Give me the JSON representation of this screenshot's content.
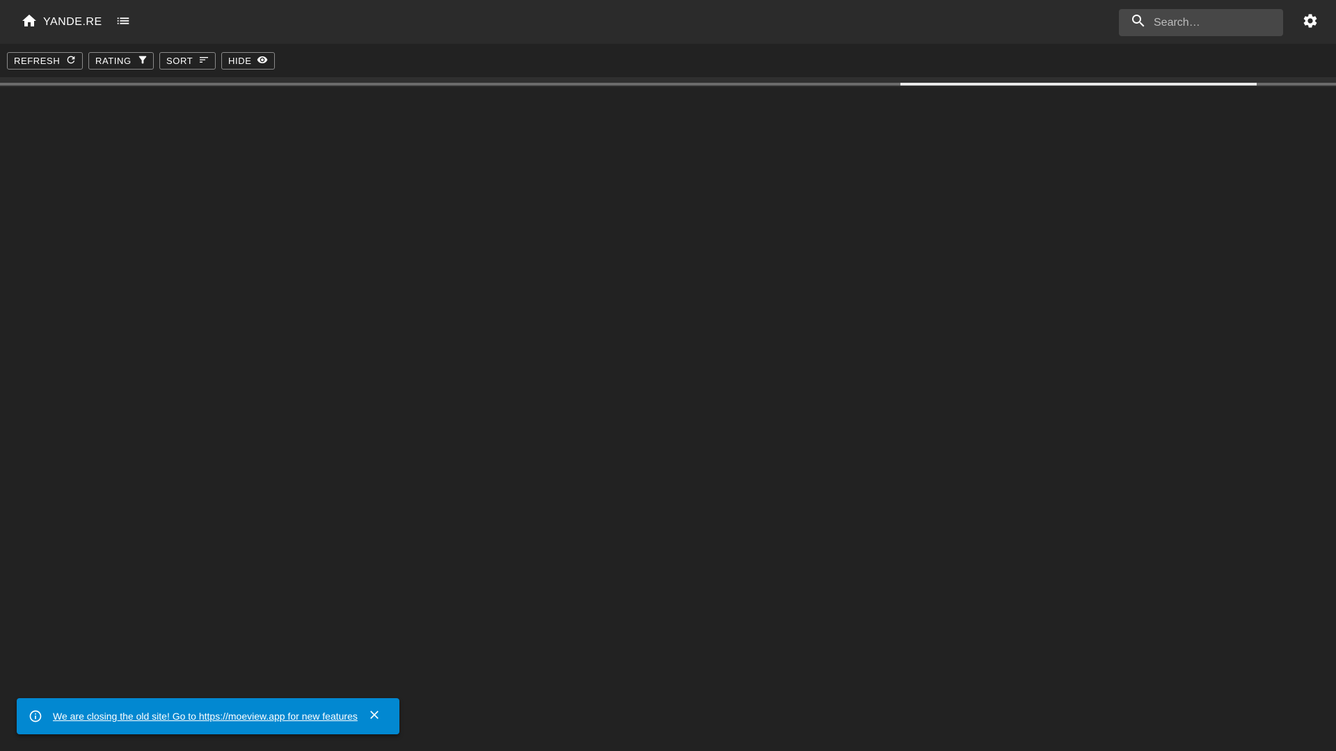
{
  "appbar": {
    "home_label": "YANDE.RE",
    "home_icon": "home-icon",
    "list_icon": "list-icon",
    "settings_icon": "gear-icon"
  },
  "search": {
    "placeholder": "Search…",
    "value": "",
    "icon": "search-icon"
  },
  "toolbar": {
    "buttons": [
      {
        "label": "REFRESH",
        "icon": "refresh-icon"
      },
      {
        "label": "RATING",
        "icon": "filter-icon"
      },
      {
        "label": "SORT",
        "icon": "sort-icon"
      },
      {
        "label": "HIDE",
        "icon": "eye-icon"
      }
    ]
  },
  "loading": {
    "indeterminate": true
  },
  "snackbar": {
    "message": "We are closing the old site! Go to https://moeview.app for new features",
    "info_icon": "info-icon",
    "close_icon": "close-icon"
  },
  "colors": {
    "background": "#222222",
    "appbar": "#2b2b2b",
    "search_field": "#474747",
    "snackbar": "#0288d1"
  }
}
